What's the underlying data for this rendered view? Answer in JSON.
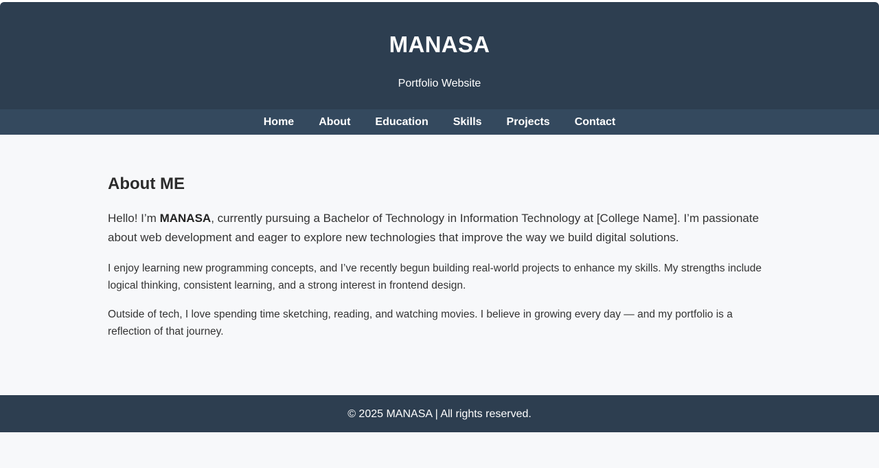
{
  "header": {
    "title": "MANASA",
    "subtitle": "Portfolio Website"
  },
  "nav": {
    "items": [
      {
        "label": "Home"
      },
      {
        "label": "About"
      },
      {
        "label": "Education"
      },
      {
        "label": "Skills"
      },
      {
        "label": "Projects"
      },
      {
        "label": "Contact"
      }
    ]
  },
  "about": {
    "heading": "About ME",
    "intro_before": "Hello! I’m ",
    "intro_name": "MANASA",
    "intro_after": ", currently pursuing a Bachelor of Technology in Information Technology at [College Name]. I’m passionate about web development and eager to explore new technologies that improve the way we build digital solutions.",
    "paragraphs": [
      "I enjoy learning new programming concepts, and I’ve recently begun building real-world projects to enhance my skills. My strengths include logical thinking, consistent learning, and a strong interest in frontend design.",
      "Outside of tech, I love spending time sketching, reading, and watching movies. I believe in growing every day — and my portfolio is a reflection of that journey."
    ]
  },
  "footer": {
    "text": "© 2025 MANASA | All rights reserved."
  },
  "colors": {
    "header_bg": "#2d3e50",
    "nav_bg": "#34495e",
    "page_bg": "#f7f8fa",
    "text": "#333333"
  }
}
